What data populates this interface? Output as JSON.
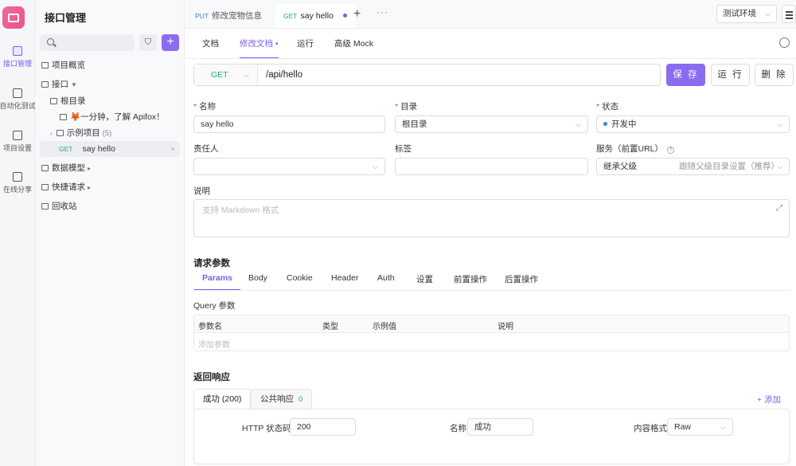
{
  "rail": {
    "items": [
      {
        "label": "接口管理",
        "active": true
      },
      {
        "label": "自动化测试",
        "active": false
      },
      {
        "label": "项目设置",
        "active": false
      },
      {
        "label": "在线分享",
        "active": false
      }
    ]
  },
  "tree": {
    "title": "接口管理",
    "search_placeholder": "",
    "nodes": [
      {
        "label": "项目概览"
      },
      {
        "label": "接口"
      },
      {
        "label": "根目录"
      },
      {
        "label": "🦊一分钟，了解 Apifox！"
      },
      {
        "label": "示例项目",
        "count": "(5)"
      },
      {
        "method": "GET",
        "label": "say hello"
      },
      {
        "label": "数据模型"
      },
      {
        "label": "快捷请求"
      },
      {
        "label": "回收站"
      }
    ]
  },
  "doc_tabs": [
    {
      "method": "PUT",
      "label": "修改宠物信息"
    },
    {
      "method": "GET",
      "label": "say hello"
    }
  ],
  "env": {
    "selected": "测试环境"
  },
  "sub_tabs": [
    "文档",
    "修改文档",
    "运行",
    "高级 Mock"
  ],
  "request": {
    "method": "GET",
    "path": "/api/hello",
    "save_label": "保 存",
    "run_label": "运 行",
    "delete_label": "删 除"
  },
  "form": {
    "name_label": "名称",
    "name_value": "say hello",
    "dir_label": "目录",
    "dir_value": "根目录",
    "status_label": "状态",
    "status_value": "开发中",
    "owner_label": "责任人",
    "owner_value": "",
    "tag_label": "标签",
    "tag_value": "",
    "service_label": "服务（前置URL）",
    "service_value": "继承父级",
    "service_hint": "跟随父级目录设置（推荐）",
    "desc_label": "说明",
    "desc_placeholder": "支持 Markdown 格式"
  },
  "params": {
    "title": "请求参数",
    "tabs": [
      "Params",
      "Body",
      "Cookie",
      "Header",
      "Auth",
      "设置",
      "前置操作",
      "后置操作"
    ],
    "query_label": "Query 参数",
    "columns": [
      "参数名",
      "类型",
      "示例值",
      "说明"
    ],
    "add_placeholder": "添加参数"
  },
  "response": {
    "title": "返回响应",
    "tabs": [
      {
        "label": "成功 (200)"
      },
      {
        "label": "公共响应",
        "badge": "0"
      }
    ],
    "add_label": "+ 添加",
    "http_code_label": "HTTP 状态码",
    "http_code_value": "200",
    "name_label": "名称",
    "name_value": "成功",
    "format_label": "内容格式",
    "format_value": "Raw"
  },
  "colors": {
    "accent": "#7e5bef",
    "get": "#20b070",
    "put": "#3b7de6",
    "required": "#e5484d"
  }
}
